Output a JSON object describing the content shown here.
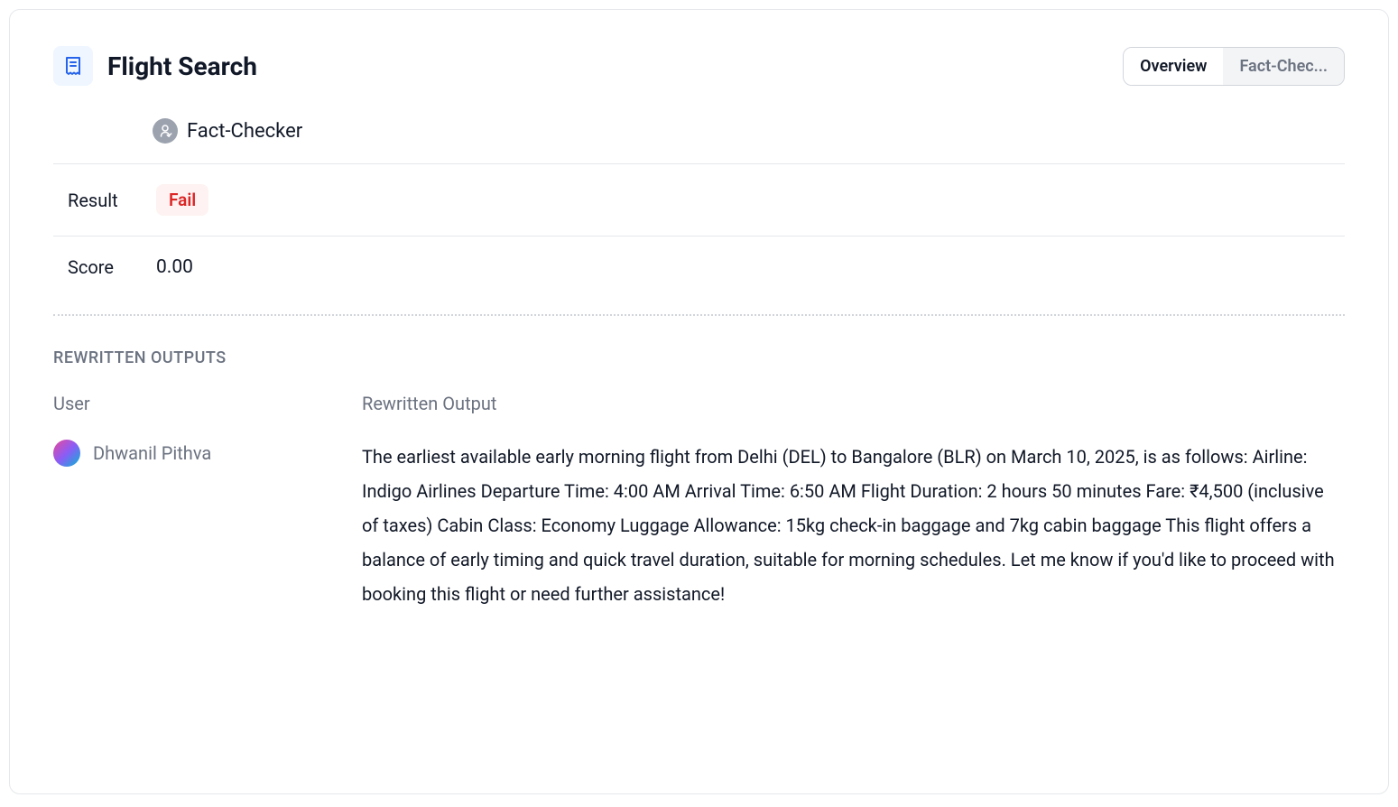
{
  "header": {
    "title": "Flight Search",
    "tabs": [
      {
        "label": "Overview",
        "active": true
      },
      {
        "label": "Fact-Chec...",
        "active": false
      }
    ]
  },
  "factChecker": {
    "label": "Fact-Checker"
  },
  "result": {
    "label": "Result",
    "value": "Fail"
  },
  "score": {
    "label": "Score",
    "value": "0.00"
  },
  "rewrittenOutputs": {
    "heading": "REWRITTEN OUTPUTS",
    "columns": {
      "user": "User",
      "rewritten": "Rewritten Output"
    },
    "rows": [
      {
        "user": "Dhwanil Pithva",
        "output": "The earliest available early morning flight from Delhi (DEL) to Bangalore (BLR) on March 10, 2025, is as follows: Airline: Indigo Airlines Departure Time: 4:00 AM Arrival Time: 6:50 AM Flight Duration: 2 hours 50 minutes Fare: ₹4,500 (inclusive of taxes) Cabin Class: Economy Luggage Allowance: 15kg check-in baggage and 7kg cabin baggage This flight offers a balance of early timing and quick travel duration, suitable for morning schedules. Let me know if you'd like to proceed with booking this flight or need further assistance!"
      }
    ]
  }
}
